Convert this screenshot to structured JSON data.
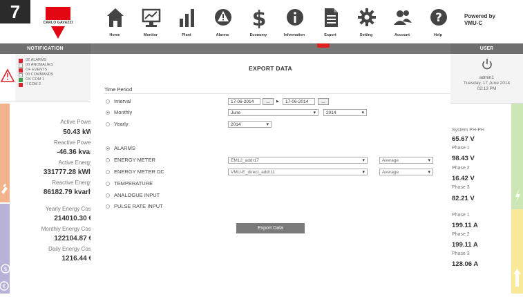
{
  "badge": "7",
  "logo": {
    "text": "CARLO GAVAZZI",
    "color": "#e30613"
  },
  "nav": [
    {
      "label": "Home",
      "icon": "home-icon"
    },
    {
      "label": "Monitor",
      "icon": "monitor-icon"
    },
    {
      "label": "Plant",
      "icon": "plant-icon"
    },
    {
      "label": "Alarms",
      "icon": "alarm-icon"
    },
    {
      "label": "Economy",
      "icon": "dollar-icon"
    },
    {
      "label": "Information",
      "icon": "info-icon"
    },
    {
      "label": "Export",
      "icon": "document-icon"
    },
    {
      "label": "Setting",
      "icon": "gear-icon"
    },
    {
      "label": "Account",
      "icon": "users-icon"
    },
    {
      "label": "Help",
      "icon": "help-icon"
    }
  ],
  "powered": {
    "line1": "Powered by",
    "line2": "VMU-C"
  },
  "notification": {
    "header": "NOTIFICATION",
    "rows": [
      {
        "status": "02",
        "text": "ALARMS",
        "color": "#d9232d"
      },
      {
        "status": "00",
        "text": "ANOMALIES",
        "color": "#ffffff"
      },
      {
        "status": "OF",
        "text": "EVENTS",
        "color": "#d9232d"
      },
      {
        "status": "00",
        "text": "COMMANDS",
        "color": "#ffffff"
      },
      {
        "status": "OK",
        "text": "COM 1",
        "color": "#3aa34a"
      },
      {
        "status": "!!",
        "text": "COM 2",
        "color": "#d9232d"
      }
    ]
  },
  "left_panel": {
    "active_power_label": "Active Power",
    "active_power_value": "50.43 kW",
    "reactive_power_label": "Reactive Power",
    "reactive_power_value": "-46.36 kvar",
    "active_energy_label": "Active Energy",
    "active_energy_value": "331777.28 kWh",
    "reactive_energy_label": "Reactive Energy",
    "reactive_energy_value": "86182.79 kvarh",
    "yearly_cost_label": "Yearly Energy Cost",
    "yearly_cost_value": "214010.30 €",
    "monthly_cost_label": "Monthly Energy Cost",
    "monthly_cost_value": "122104.87 €",
    "daily_cost_label": "Daily Energy Cost",
    "daily_cost_value": "1216.44 €"
  },
  "user_panel": {
    "header": "USER",
    "username": "admin1",
    "date": "Tuesday, 17 June 2014",
    "time": "02:13 PM",
    "system_label": "System PH-PH",
    "system_value": "65.67 V",
    "p1v_label": "Phase 1",
    "p1v_value": "98.43 V",
    "p2v_label": "Phase 2",
    "p2v_value": "16.42 V",
    "p3v_label": "Phase 3",
    "p3v_value": "82.21 V",
    "p1a_label": "Phase 1",
    "p1a_value": "199.11 A",
    "p2a_label": "Phase 2",
    "p2a_value": "199.11 A",
    "p3a_label": "Phase 3",
    "p3a_value": "128.06 A"
  },
  "export": {
    "title": "EXPORT DATA",
    "time_period_label": "Time Period",
    "interval_label": "Interval",
    "interval_from": "17-06-2014",
    "interval_to": "17-06-2014",
    "dots": "...",
    "monthly_label": "Monthly",
    "month_value": "June",
    "month_year_value": "2014",
    "yearly_label": "Yearly",
    "year_value": "2014",
    "alarms_label": "ALARMS",
    "energy_meter_label": "ENERGY METER",
    "energy_meter_value": "EM12_addr17",
    "energy_meter_agg": "Average",
    "energy_meter_dc_label": "ENERGY METER DC",
    "energy_meter_dc_value": "VMU-E_direct_addr11",
    "energy_meter_dc_agg": "Average",
    "temperature_label": "TEMPERATURE",
    "analogue_label": "ANALOGUE INPUT",
    "pulse_label": "PULSE RATE INPUT",
    "button_label": "Export Data"
  },
  "colors": {
    "orange": "#f3b48d",
    "purple": "#b8b2d9",
    "green": "#cde6b5",
    "yellow": "#f8e99b",
    "header": "#6e6e6e"
  }
}
